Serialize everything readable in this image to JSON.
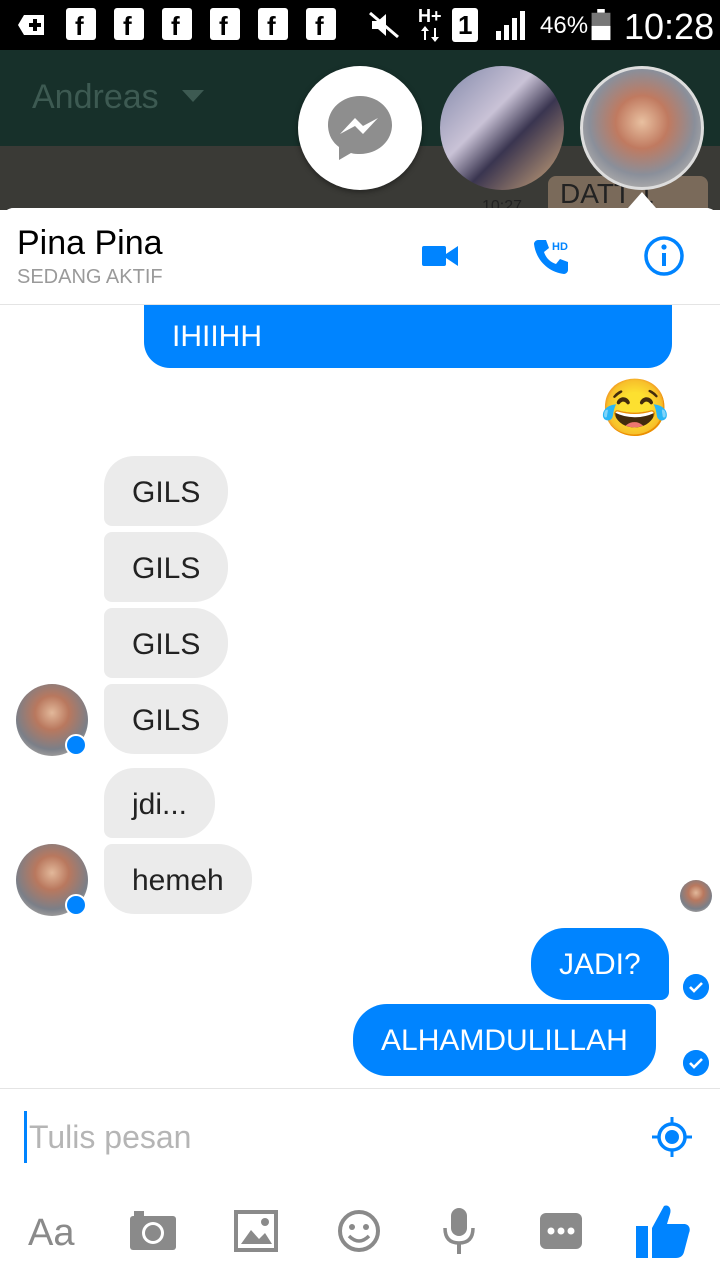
{
  "status_bar": {
    "fb_letter": "f",
    "network": "H+",
    "sim": "1",
    "battery_percent": "46%",
    "time": "10:28"
  },
  "background_app": {
    "title": "Andreas",
    "bubble_text": "DATT 1",
    "time": "10:27"
  },
  "chat": {
    "contact_name": "Pina Pina",
    "contact_status": "SEDANG AKTIF",
    "header_icons": [
      "video-call-icon",
      "hd-voice-call-icon",
      "info-icon"
    ],
    "hd_label": "HD",
    "messages": [
      {
        "from": "me",
        "text": "IHIIHH"
      },
      {
        "from": "me",
        "emoji": "😂"
      },
      {
        "from": "them",
        "text": "GILS"
      },
      {
        "from": "them",
        "text": "GILS"
      },
      {
        "from": "them",
        "text": "GILS"
      },
      {
        "from": "them",
        "text": "GILS"
      },
      {
        "from": "them",
        "text": "jdi..."
      },
      {
        "from": "them",
        "text": "hemeh"
      },
      {
        "from": "me",
        "text": "JADI?"
      },
      {
        "from": "me",
        "text": "ALHAMDULILLAH"
      }
    ]
  },
  "composer": {
    "placeholder": "Tulis pesan",
    "text_button": "Aa",
    "toolbar_icons": [
      "text-icon",
      "camera-icon",
      "gallery-icon",
      "emoji-icon",
      "mic-icon",
      "more-icon",
      "like-icon"
    ]
  },
  "colors": {
    "accent": "#0084ff",
    "incoming_bubble": "#ebebeb",
    "header_status": "#9a9a9a"
  }
}
